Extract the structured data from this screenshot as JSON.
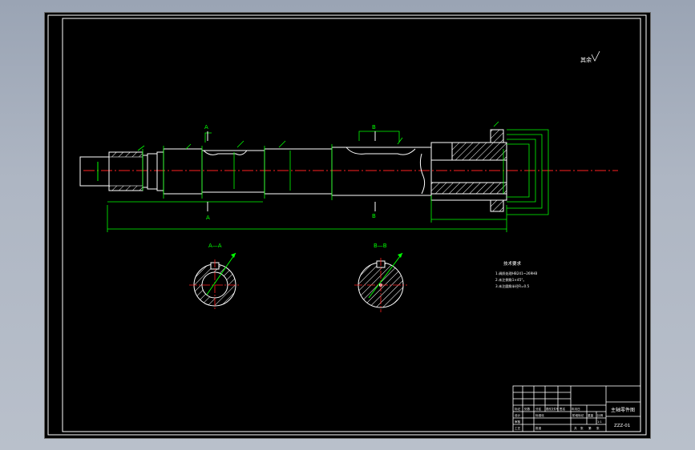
{
  "drawing": {
    "title": "主轴零件图",
    "drawing_number": "ZZZ-01",
    "roughness_note": "其余",
    "tech_req_title": "技术要求",
    "tech_req_lines": [
      "1.调质处理HB241~269HB",
      "2.未注倒角1×45°。",
      "3.未注圆角半径R=0.5"
    ],
    "section_a_label": "A—A",
    "section_b_label": "B—B",
    "cut_a": "A",
    "cut_b": "B",
    "title_block": {
      "cells": [
        "标记",
        "处数",
        "分区",
        "更改文件号",
        "签名",
        "年月日",
        "设计",
        "标准化",
        "阶段标记",
        "重量",
        "比例",
        "审核",
        "工艺",
        "批准",
        "共",
        "张",
        "第",
        "张",
        "1:1"
      ]
    }
  },
  "colors": {
    "background": "#000000",
    "outline": "#ffffff",
    "dimension": "#00ff00",
    "centerline": "#ff2020"
  }
}
